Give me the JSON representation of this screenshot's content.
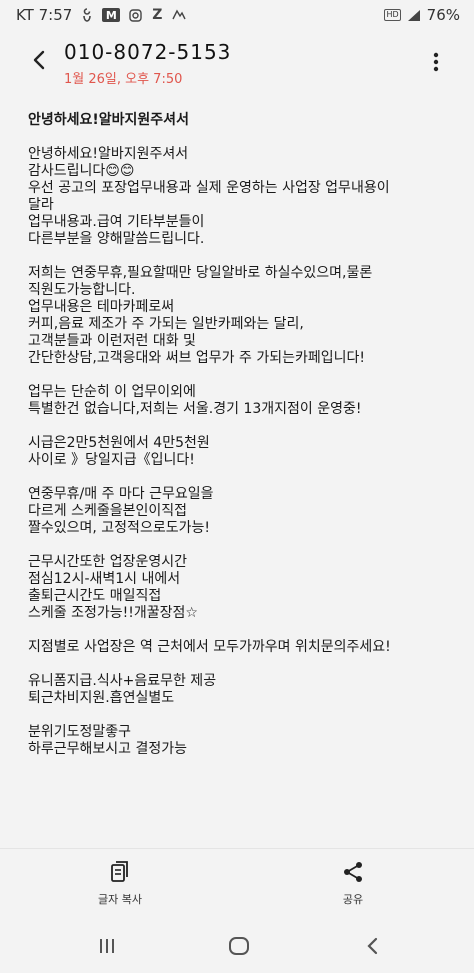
{
  "status_bar": {
    "carrier_time": "KT 7:57",
    "icon_m": "M",
    "icon_z": "Z",
    "hd": "HD",
    "battery": "76%"
  },
  "header": {
    "contact": "010-8072-5153",
    "date": "1월 26일, 오후 7:50"
  },
  "message": {
    "subject": "안녕하세요!알바지원주셔서",
    "lines": [
      "안녕하세요!알바지원주셔서",
      "감사드립니다😊😊",
      "우선 공고의 포장업무내용과 실제 운영하는 사업장 업무내용이",
      "달라",
      "업무내용과.급여 기타부분들이",
      "다른부분을 양해말씀드립니다.",
      "",
      "저희는 연중무휴,필요할때만 당일알바로 하실수있으며,물론",
      "직원도가능합니다.",
      "업무내용은 테마카페로써",
      "커피,음료 제조가 주 가되는 일반카페와는 달리,",
      "고객분들과 이런저런 대화 및",
      "간단한상담,고객응대와 써브 업무가 주 가되는카페입니다!",
      "",
      "업무는 단순히 이 업무이외에",
      "특별한건 없습니다,저희는 서울.경기 13개지점이 운영중!",
      "",
      "시급은2만5천원에서 4만5천원",
      "사이로 》당일지급《입니다!",
      "",
      "연중무휴/매 주 마다 근무요일을",
      "다르게 스케줄을본인이직접",
      "짤수있으며, 고정적으로도가능!",
      "",
      "근무시간또한 업장운영시간",
      "점심12시-새벽1시 내에서",
      "출퇴근시간도 매일직접",
      "스케줄 조정가능!!개꿀장점☆",
      "",
      "지점별로 사업장은 역 근처에서 모두가까우며 위치문의주세요!",
      "",
      "유니폼지급.식사+음료무한 제공",
      "퇴근차비지원.흡연실별도",
      "",
      "분위기도정말좋구",
      "하루근무해보시고 결정가능"
    ]
  },
  "actions": {
    "copy_label": "글자 복사",
    "share_label": "공유"
  }
}
